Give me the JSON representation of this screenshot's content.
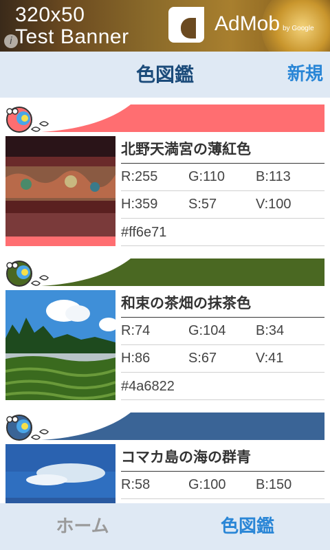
{
  "ad": {
    "line1": "320x50",
    "line2": "Test Banner",
    "brand": "AdMob",
    "by": "by Google",
    "info_icon": "info-icon"
  },
  "header": {
    "title": "色図鑑",
    "new_button": "新規"
  },
  "colors": [
    {
      "name": "北野天満宮の薄紅色",
      "r": "R:255",
      "g": "G:110",
      "b": "B:113",
      "h": "H:359",
      "s": "S:57",
      "v": "V:100",
      "hex": "#ff6e71",
      "swatch": "#ff6e71",
      "photo": "shrine-carving"
    },
    {
      "name": "和束の茶畑の抹茶色",
      "r": "R:74",
      "g": "G:104",
      "b": "B:34",
      "h": "H:86",
      "s": "S:67",
      "v": "V:41",
      "hex": "#4a6822",
      "swatch": "#4a6822",
      "photo": "tea-field"
    },
    {
      "name": "コマカ島の海の群青",
      "r": "R:58",
      "g": "G:100",
      "b": "B:150",
      "swatch": "#3a6496",
      "photo": "ocean-sky"
    }
  ],
  "tabs": {
    "home": "ホーム",
    "catalog": "色図鑑"
  }
}
